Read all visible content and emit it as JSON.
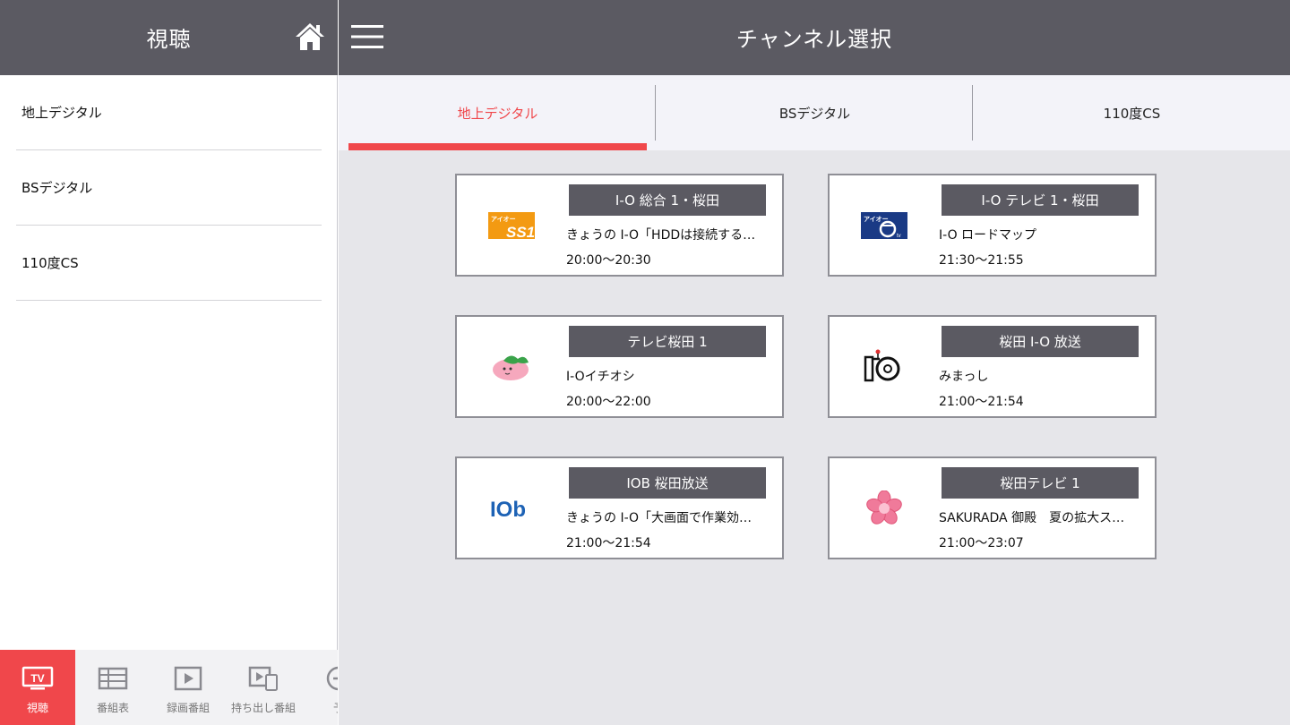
{
  "sidebar": {
    "title": "視聴",
    "items": [
      {
        "label": "地上デジタル"
      },
      {
        "label": "BSデジタル"
      },
      {
        "label": "110度CS"
      }
    ]
  },
  "bottom_nav": [
    {
      "label": "視聴",
      "icon": "tv-icon",
      "active": true
    },
    {
      "label": "番組表",
      "icon": "program-guide-icon",
      "active": false
    },
    {
      "label": "録画番組",
      "icon": "recorded-play-icon",
      "active": false
    },
    {
      "label": "持ち出し番組",
      "icon": "takeout-icon",
      "active": false
    },
    {
      "label": "予",
      "icon": "reservation-icon",
      "active": false
    }
  ],
  "header": {
    "title": "チャンネル選択"
  },
  "tabs": [
    {
      "label": "地上デジタル",
      "active": true
    },
    {
      "label": "BSデジタル",
      "active": false
    },
    {
      "label": "110度CS",
      "active": false
    }
  ],
  "channels": [
    {
      "name": "I-O 総合 1・桜田",
      "program": "きょうの I-O「HDDは接続する…",
      "time": "20:00〜20:30",
      "logo": "ss1-logo",
      "logo_text": "アイオー SS1"
    },
    {
      "name": "I-O テレビ 1・桜田",
      "program": "I-O ロードマップ",
      "time": "21:30〜21:55",
      "logo": "io-tv-logo",
      "logo_text": "アイオー"
    },
    {
      "name": "テレビ桜田 1",
      "program": "I-Oイチオシ",
      "time": "20:00〜22:00",
      "logo": "peach-mascot-logo",
      "logo_text": ""
    },
    {
      "name": "桜田 I-O 放送",
      "program": "みまっし",
      "time": "21:00〜21:54",
      "logo": "io-camera-logo",
      "logo_text": ""
    },
    {
      "name": "IOB 桜田放送",
      "program": "きょうの I-O「大画面で作業効…",
      "time": "21:00〜21:54",
      "logo": "iob-logo",
      "logo_text": "IOb"
    },
    {
      "name": "桜田テレビ 1",
      "program": "SAKURADA 御殿　夏の拡大ス…",
      "time": "21:00〜23:07",
      "logo": "sakura-flower-logo",
      "logo_text": ""
    }
  ],
  "colors": {
    "header_bg": "#5b5a62",
    "accent": "#f0474b",
    "content_bg": "#e6e6ea",
    "tab_bg": "#f3f3f9"
  }
}
